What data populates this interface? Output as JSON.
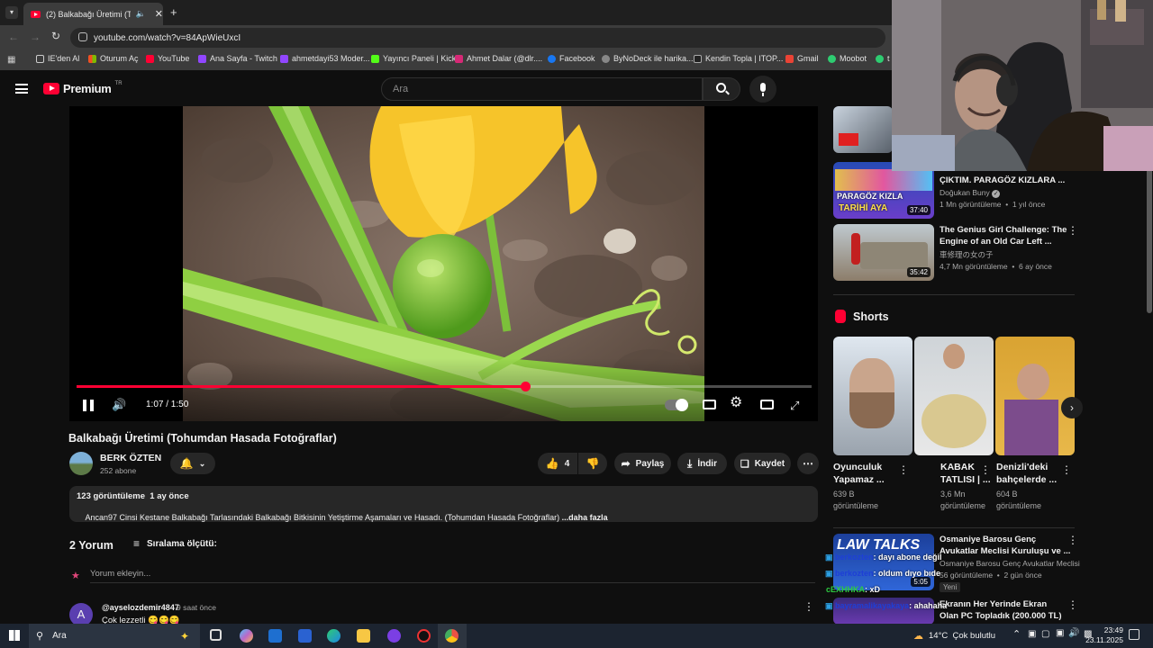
{
  "browser": {
    "tab_title": "(2) Balkabağı Üretimi (Tohu",
    "url": "youtube.com/watch?v=84ApWieUxcI",
    "bookmarks": [
      "IE'den Al",
      "Oturum Aç",
      "YouTube",
      "Ana Sayfa - Twitch",
      "ahmetdayi53 Moder...",
      "Yayıncı Paneli | Kick",
      "Ahmet Dalar (@dlr....",
      "Facebook",
      "ByNoDeck ile harika...",
      "Kendin Topla | ITOP...",
      "Gmail",
      "Moobot"
    ],
    "bookmark_overflow": "t"
  },
  "header": {
    "logo": "Premium",
    "logo_sup": "TR",
    "search_placeholder": "Ara"
  },
  "player": {
    "time": "1:07 / 1:50",
    "progress": 0.61
  },
  "video": {
    "title": "Balkabağı Üretimi (Tohumdan Hasada Fotoğraflar)",
    "channel": "BERK ÖZTEN",
    "subscribers": "252 abone",
    "likes": "4",
    "share": "Paylaş",
    "download": "İndir",
    "save": "Kaydet",
    "views_date": "123 görüntüleme  1 ay önce",
    "description": "Ancan97 Cinsi Kestane Balkabağı Tarlasındaki Balkabağı Bitkisinin Yetiştirme Aşamaları ve Hasadı. (Tohumdan Hasada Fotoğraflar) ",
    "more": "...daha fazla"
  },
  "comments": {
    "count": "2 Yorum",
    "sort": "Sıralama ölçütü:",
    "add_placeholder": "Yorum ekleyin...",
    "first": {
      "avatar": "A",
      "author": "@ayselozdemir4847",
      "time": "9 saat önce",
      "text": "Çok lezzetli 😋😋😋"
    }
  },
  "related": [
    {
      "title_l1": "ÇIKTIM. PARAGÖZ KIZLARA ...",
      "channel": "Doğukan Buny",
      "meta": "1 Mn görüntüleme  •  1 yıl önce",
      "duration": "37:40",
      "thumb_text_1": "PARAGÖZ KIZLA",
      "thumb_text_2": "TARİHİ AYA"
    },
    {
      "title_l1": "The Genius Girl Challenge: The",
      "title_l2": "Engine of an Old Car Left ...",
      "channel": "車修理の女の子",
      "meta": "4,7 Mn görüntüleme  •  6 ay önce",
      "duration": "35:42"
    },
    {
      "title_l1": "Osmaniye Barosu Genç",
      "title_l2": "Avukatlar Meclisi Kuruluşu ve ...",
      "channel": "Osmaniye Barosu Genç Avukatlar Meclisi",
      "meta": "56 görüntüleme  •  2 gün önce",
      "badge": "Yeni",
      "duration": "5:05",
      "thumb_text": "LAW TALKS"
    },
    {
      "title_l1": "Ekranın Her Yerinde Ekran",
      "title_l2": "Olan PC Topladık (200.000 TL)"
    }
  ],
  "shorts": {
    "heading": "Shorts",
    "items": [
      {
        "title_l1": "Oyunculuk",
        "title_l2": "Yapamaz ...",
        "views_l1": "639 B",
        "views_l2": "görüntüleme"
      },
      {
        "title_l1": "KABAK",
        "title_l2": "TATLISI | ...",
        "views_l1": "3,6 Mn",
        "views_l2": "görüntüleme"
      },
      {
        "title_l1": "Denizli'deki",
        "title_l2": "bahçelerde ...",
        "views_l1": "604 B",
        "views_l2": "görüntüleme"
      }
    ]
  },
  "chat": [
    {
      "user": "berkozten",
      "msg": ": dayı abone değil"
    },
    {
      "user": "berkozten",
      "msg": ": oldum dıyo bıde"
    },
    {
      "user": "cEXHHKA",
      "msg": ": xD"
    },
    {
      "user": "bayramalikayakaya",
      "msg": ": ahahaha"
    }
  ],
  "taskbar": {
    "search": "Ara",
    "weather": "14°C  Çok bulutlu",
    "time": "23:49",
    "date": "23.11.2025"
  },
  "colors": {
    "accent_red": "#ff0033",
    "bg": "#0f0f0f",
    "chip": "#272727"
  }
}
